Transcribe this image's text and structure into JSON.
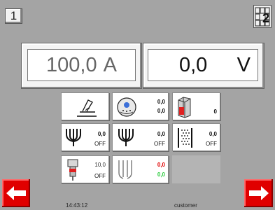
{
  "nav": {
    "left_label": "1",
    "right_label": "2"
  },
  "displays": {
    "current": {
      "value": "100,0",
      "unit": "A"
    },
    "voltage": {
      "value": "0,0",
      "unit": "V"
    }
  },
  "tiles": {
    "gas": {
      "top": "0,0",
      "bottom": "0,0"
    },
    "counter": {
      "value": "0"
    },
    "preheat": {
      "value": "0,0",
      "state": "OFF"
    },
    "postheat": {
      "value": "0,0",
      "state": "OFF"
    },
    "pattern": {
      "value": "0,0",
      "state": "OFF"
    },
    "feeder": {
      "value": "10,0",
      "state": "OFF"
    },
    "wave": {
      "value_red": "0,0",
      "value_green": "0,0"
    }
  },
  "status": {
    "time": "14:43:12",
    "user": "customer"
  },
  "colors": {
    "background": "#a4a4a4",
    "arrow_red": "#e00000",
    "value_red": "#e00000",
    "value_green": "#2ecc40"
  }
}
